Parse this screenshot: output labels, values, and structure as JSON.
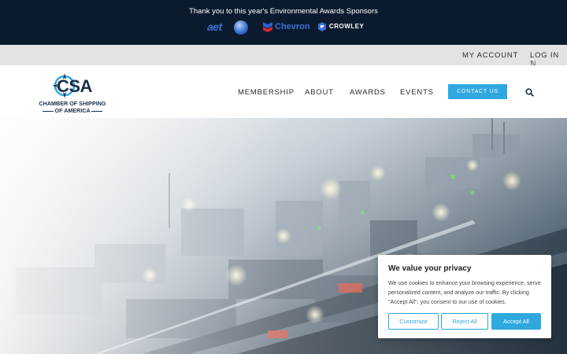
{
  "sponsor_bar": {
    "title": "Thank you to this year's Environmental Awards Sponsors",
    "sponsors": [
      {
        "name": "aet",
        "icon": "globe-icon"
      },
      {
        "name": "Chevron",
        "icon": "chevron-logo-icon"
      },
      {
        "name": "CROWLEY",
        "icon": "crowley-logo-icon"
      }
    ]
  },
  "account_bar": {
    "my_account": "MY ACCOUNT",
    "log_in": "LOG IN ℕ"
  },
  "brand": {
    "mark": "CSA",
    "name_line1": "CHAMBER OF SHIPPING",
    "name_line2": "OF AMERICA"
  },
  "nav": {
    "items": [
      "MEMBERSHIP",
      "ABOUT",
      "AWARDS",
      "EVENTS"
    ],
    "contact": "CONTACT US",
    "search_icon": "search-icon"
  },
  "hero": {
    "image": "industrial port at night aerial photo"
  },
  "cookie": {
    "title": "We value your privacy",
    "text": "We use cookies to enhance your browsing experience, serve personalized content, and analyze our traffic. By clicking \"Accept All\", you consent to our use of cookies.",
    "customize": "Customize",
    "reject": "Reject All",
    "accept": "Accept All"
  },
  "colors": {
    "sponsor_bg": "#0b1b2d",
    "account_bg": "#e3e3e3",
    "accent": "#2ea8df",
    "brand_navy": "#1b2e4a"
  }
}
